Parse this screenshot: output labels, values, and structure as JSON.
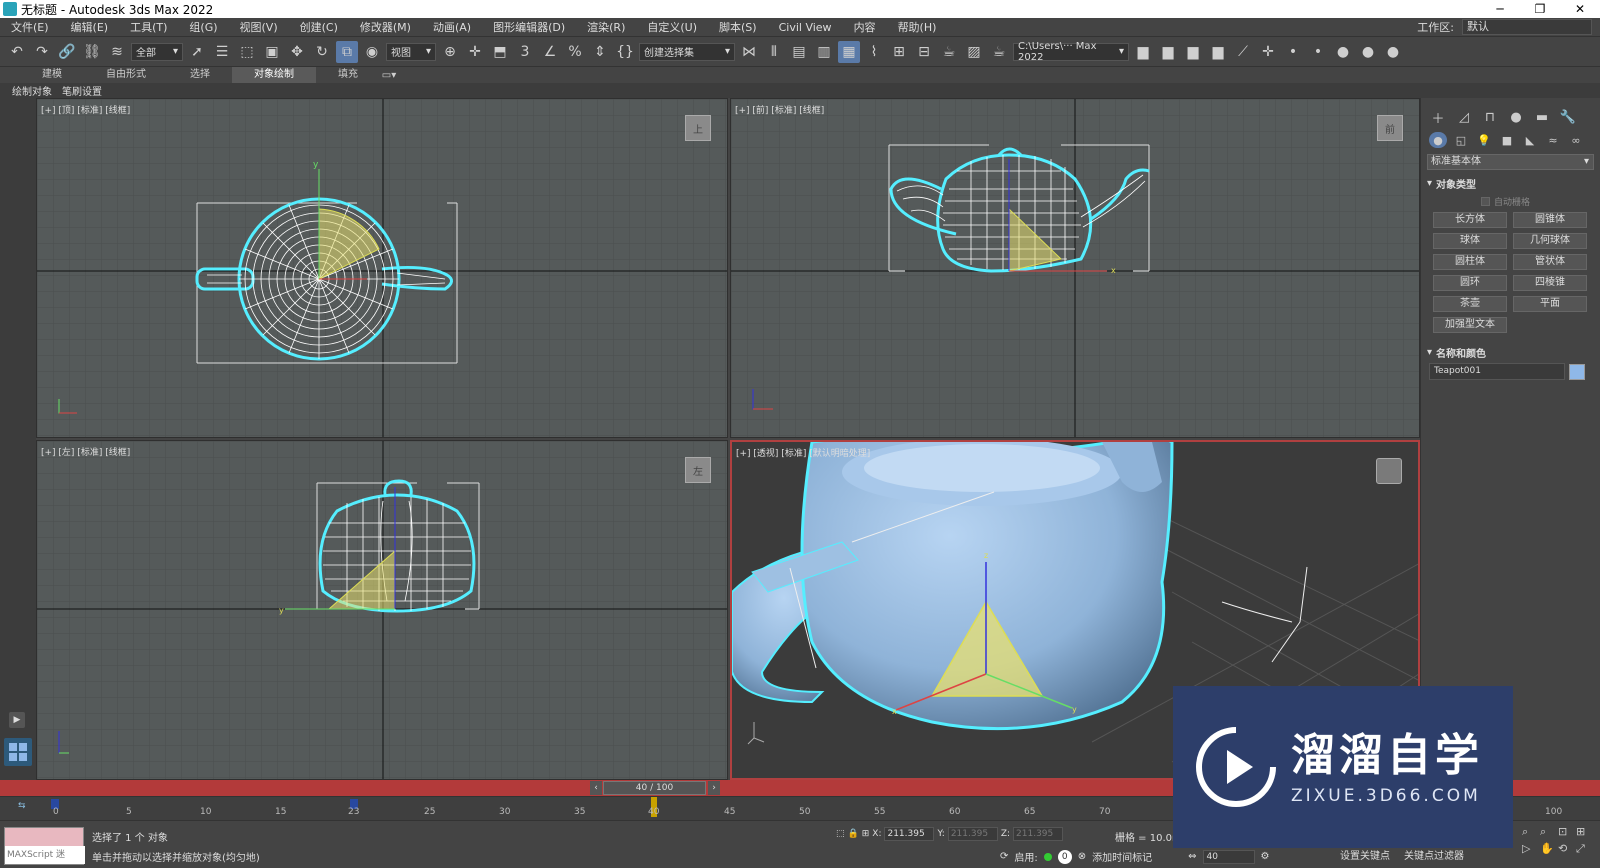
{
  "window": {
    "title": "无标题 - Autodesk 3ds Max 2022"
  },
  "menu": {
    "items": [
      "文件(E)",
      "编辑(E)",
      "工具(T)",
      "组(G)",
      "视图(V)",
      "创建(C)",
      "修改器(M)",
      "动画(A)",
      "图形编辑器(D)",
      "渲染(R)",
      "自定义(U)",
      "脚本(S)",
      "Civil View",
      "内容",
      "帮助(H)"
    ],
    "workspace_label": "工作区:",
    "workspace_value": "默认"
  },
  "toolbar": {
    "selection_filter": "全部",
    "ref_coord": "视图",
    "named_selection": "创建选择集",
    "project_path": "C:\\Users\\··· Max 2022"
  },
  "ribbon": {
    "tabs": [
      "建模",
      "自由形式",
      "选择",
      "对象绘制",
      "填充"
    ],
    "active_tab": "对象绘制",
    "sub": [
      "绘制对象",
      "笔刷设置"
    ]
  },
  "viewports": {
    "top": {
      "label": "[+] [顶] [标准] [线框]",
      "cube": "上"
    },
    "front": {
      "label": "[+] [前] [标准] [线框]",
      "cube": "前"
    },
    "left": {
      "label": "[+] [左] [标准] [线框]",
      "cube": "左"
    },
    "persp": {
      "label": "[+] [透视] [标准] [默认明暗处理]"
    }
  },
  "command_panel": {
    "category": "标准基本体",
    "object_type_title": "对象类型",
    "autogrid": "自动栅格",
    "buttons": [
      "长方体",
      "圆锥体",
      "球体",
      "几何球体",
      "圆柱体",
      "管状体",
      "圆环",
      "四棱锥",
      "茶壶",
      "平面",
      "加强型文本"
    ],
    "name_color_title": "名称和颜色",
    "object_name": "Teapot001",
    "object_color": "#8fb8e8"
  },
  "timeline": {
    "frame_display": "40 / 100",
    "current": 40,
    "total": 100,
    "ticks": [
      "0",
      "5",
      "10",
      "15",
      "23",
      "25",
      "30",
      "35",
      "40",
      "45",
      "50",
      "55",
      "60",
      "65",
      "70",
      "100"
    ]
  },
  "status": {
    "maxscript": "MAXScript 迷",
    "selected": "选择了 1 个 对象",
    "prompt": "单击并拖动以选择并缩放对象(均匀地)",
    "x_label": "X:",
    "x": "211.395",
    "y_label": "Y:",
    "y": "211.395",
    "z_label": "Z:",
    "z": "211.395",
    "grid": "栅格 = 10.0m",
    "enable": "启用:",
    "enable_value": "0",
    "add_time_tag": "添加时间标记",
    "frame": "40",
    "set_key": "设置关键点",
    "key_filters": "关键点过滤器"
  },
  "watermark": {
    "brand": "溜溜自学",
    "url": "ZIXUE.3D66.COM"
  }
}
